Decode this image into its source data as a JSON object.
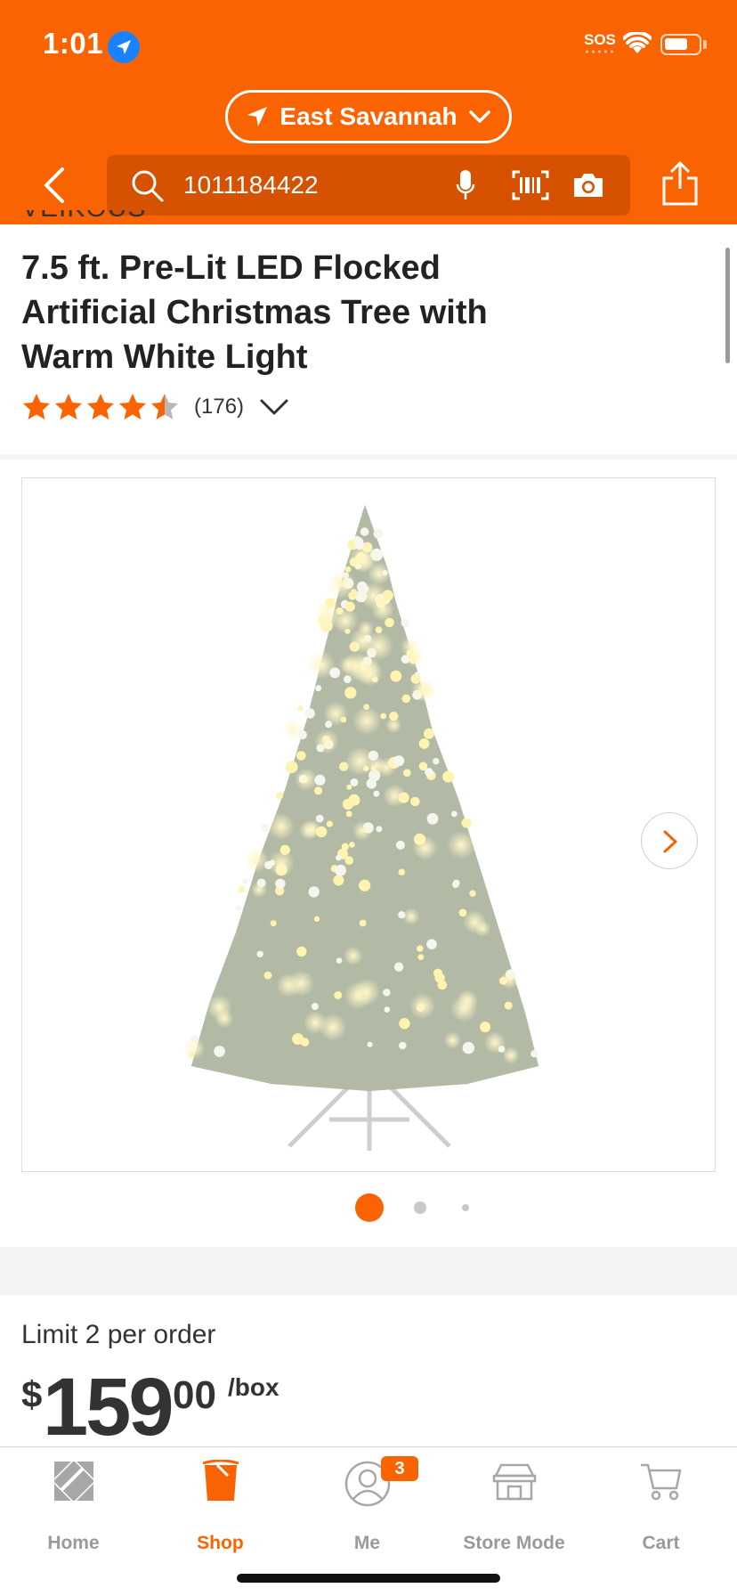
{
  "status_bar": {
    "time": "1:01",
    "sos": "SOS",
    "battery_fraction": 0.7
  },
  "header": {
    "store_location": "East Savannah",
    "search_value": "1011184422",
    "brand_color": "#f96302"
  },
  "product": {
    "brand": "VEIKOUS",
    "title": "7.5 ft. Pre-Lit LED Flocked Artificial Christmas Tree with Warm White Light",
    "rating": 4.5,
    "review_count": "(176)"
  },
  "gallery": {
    "image_alt": "flocked christmas tree with warm white lights",
    "current_index": 1,
    "total_images": 3
  },
  "price": {
    "limit_text": "Limit 2 per order",
    "symbol": "$",
    "whole": "159",
    "cents": "00",
    "unit": "/box"
  },
  "tabbar": {
    "items": [
      {
        "label": "Home",
        "icon": "home-depot-logo-icon",
        "active": false
      },
      {
        "label": "Shop",
        "icon": "bucket-icon",
        "active": true
      },
      {
        "label": "Me",
        "icon": "person-icon",
        "active": false,
        "badge": "3"
      },
      {
        "label": "Store Mode",
        "icon": "store-icon",
        "active": false
      },
      {
        "label": "Cart",
        "icon": "cart-icon",
        "active": false
      }
    ]
  }
}
